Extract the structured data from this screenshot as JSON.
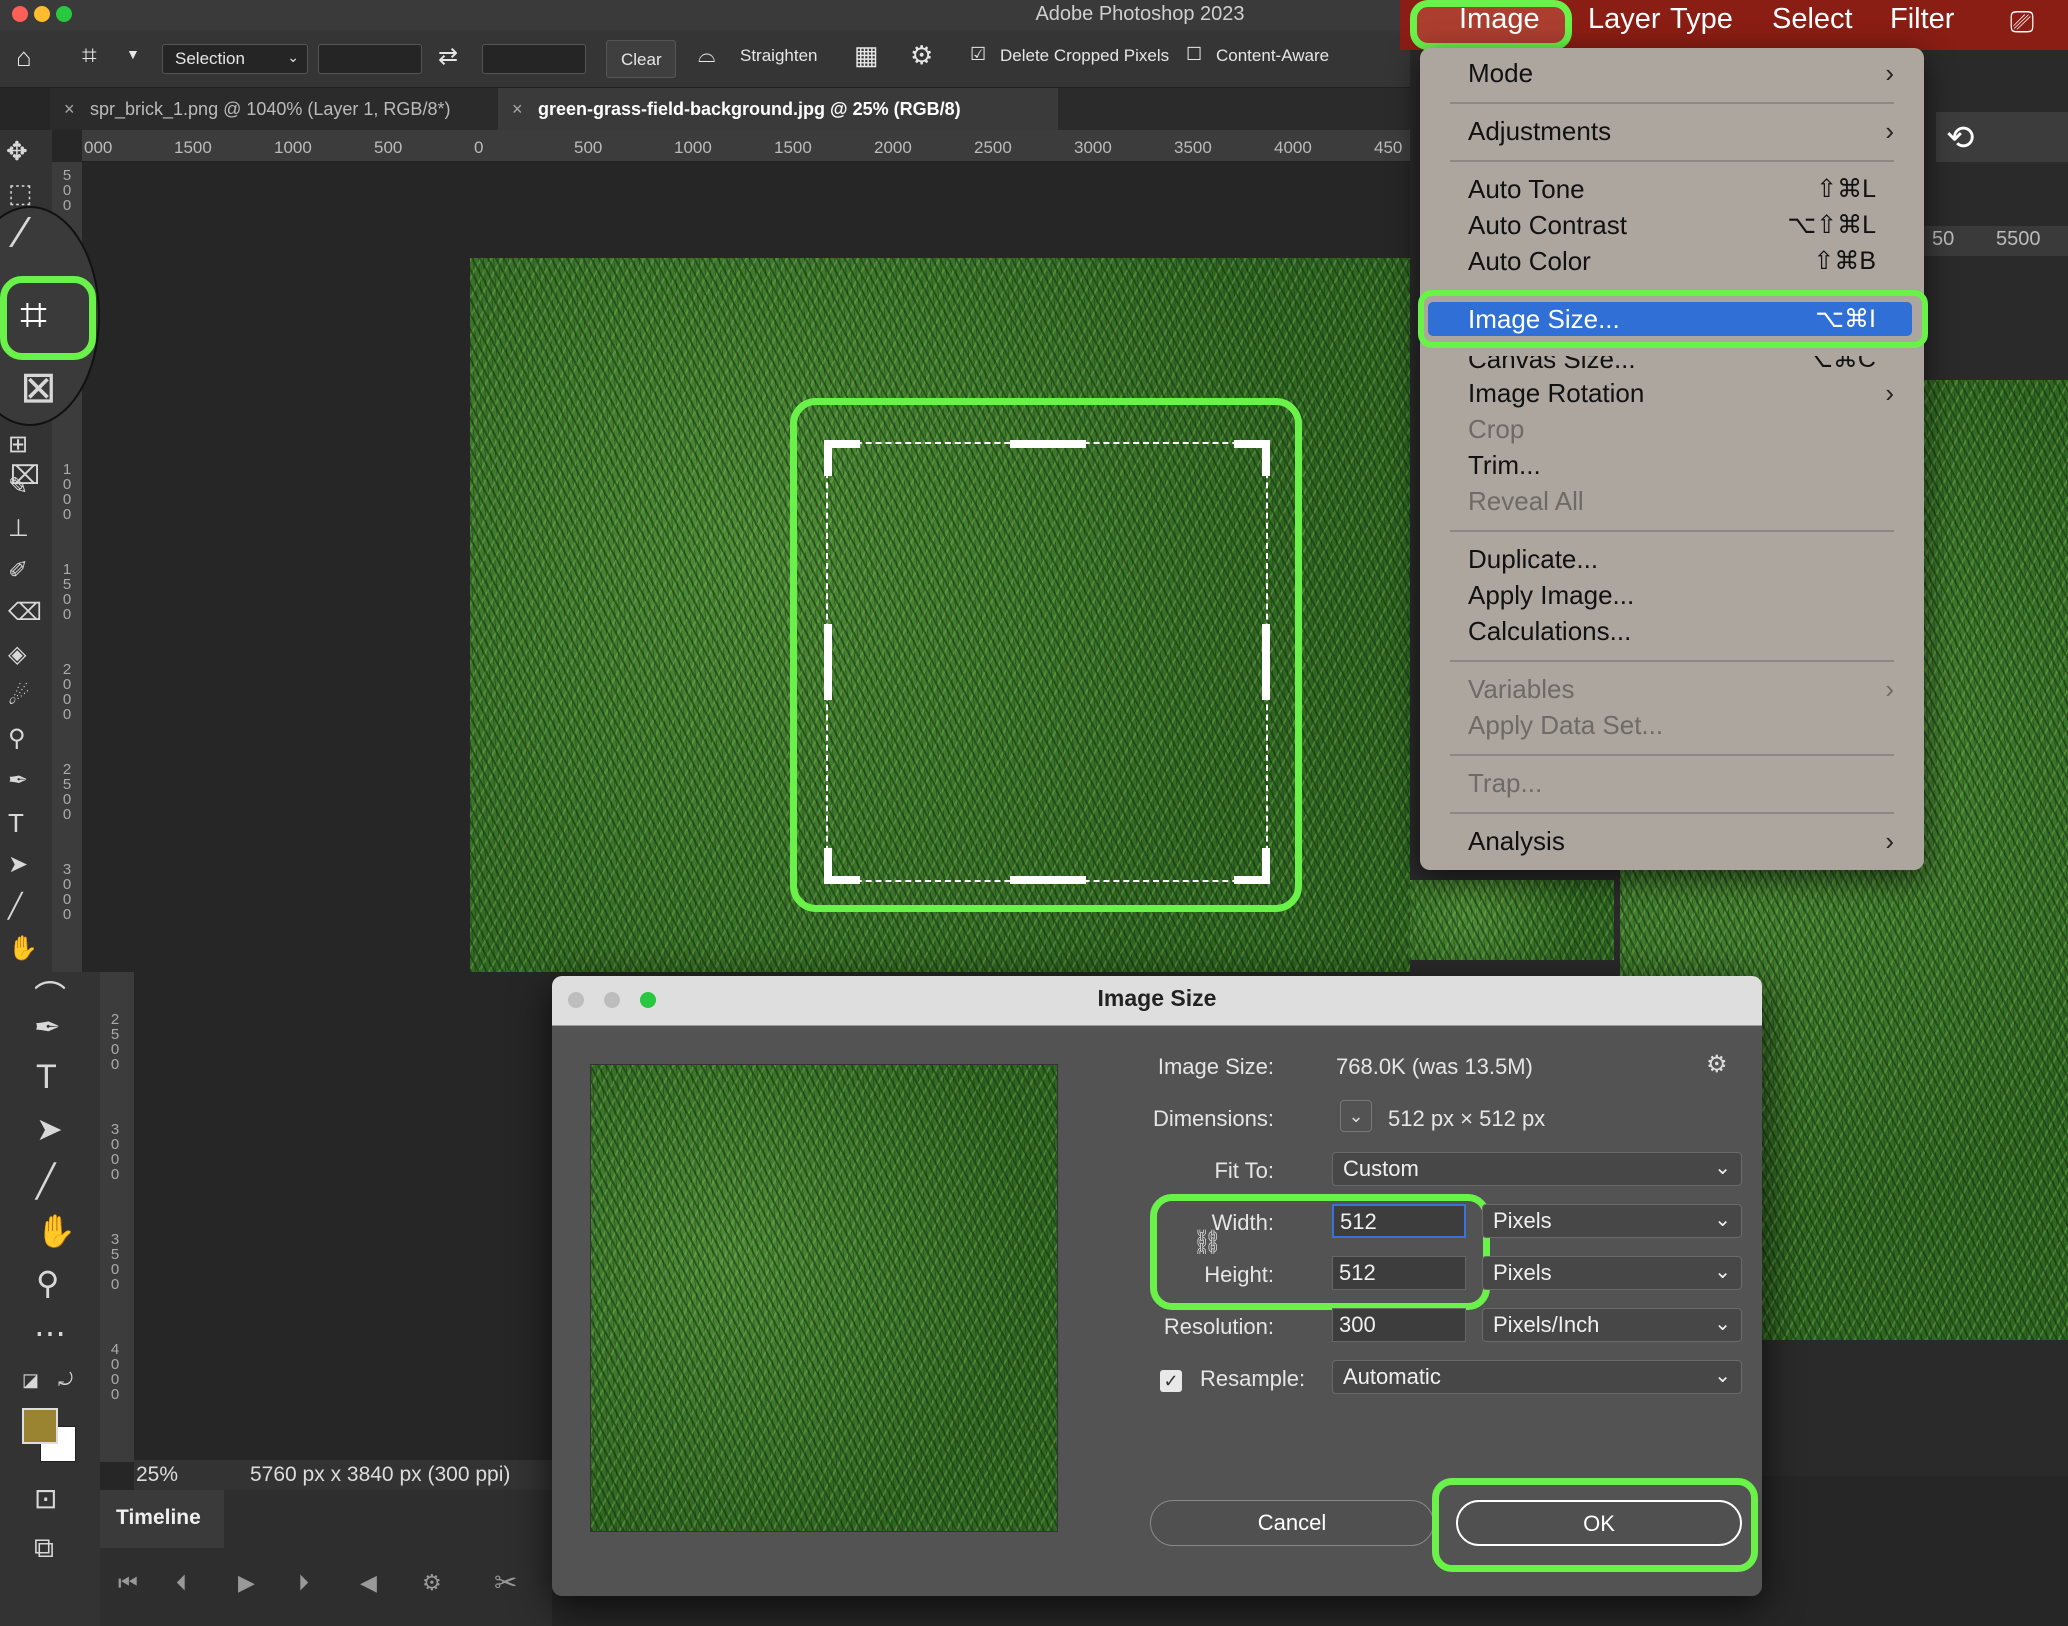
{
  "app": {
    "title": "Adobe Photoshop 2023",
    "menus": [
      "Image",
      "Layer",
      "Type",
      "Select",
      "Filter"
    ]
  },
  "options_bar": {
    "mode_select": "Selection",
    "clear_label": "Clear",
    "straighten_label": "Straighten",
    "delete_cropped_label": "Delete Cropped Pixels",
    "content_aware_label": "Content-Aware"
  },
  "tabs": [
    {
      "label": "spr_brick_1.png @ 1040% (Layer 1, RGB/8*)",
      "active": false
    },
    {
      "label": "green-grass-field-background.jpg @ 25% (RGB/8)",
      "active": true
    }
  ],
  "ruler": {
    "ticks": [
      "000",
      "1500",
      "1000",
      "500",
      "0",
      "500",
      "1000",
      "1500",
      "2000",
      "2500",
      "3000",
      "3500",
      "4000",
      "450"
    ],
    "vertical_ticks": [
      "500",
      "1000",
      "1500",
      "2000",
      "2500",
      "3000"
    ],
    "vertical_ticks_lower": [
      "2500",
      "3000",
      "3500",
      "4000"
    ],
    "right_tick": "5500",
    "right_tick_partial": "50"
  },
  "image_menu": {
    "items": [
      {
        "label": "Mode",
        "shortcut": "",
        "submenu": true,
        "disabled": false
      },
      {
        "label": "Adjustments",
        "shortcut": "",
        "submenu": true,
        "disabled": false
      },
      {
        "label": "Auto Tone",
        "shortcut": "⇧⌘L",
        "submenu": false,
        "disabled": false
      },
      {
        "label": "Auto Contrast",
        "shortcut": "⌥⇧⌘L",
        "submenu": false,
        "disabled": false
      },
      {
        "label": "Auto Color",
        "shortcut": "⇧⌘B",
        "submenu": false,
        "disabled": false
      },
      {
        "label": "Image Size...",
        "shortcut": "⌥⌘I",
        "submenu": false,
        "disabled": false,
        "highlighted": true
      },
      {
        "label": "Canvas Size...",
        "shortcut": "⌥⌘C",
        "submenu": false,
        "disabled": false
      },
      {
        "label": "Image Rotation",
        "shortcut": "",
        "submenu": true,
        "disabled": false
      },
      {
        "label": "Crop",
        "shortcut": "",
        "submenu": false,
        "disabled": true
      },
      {
        "label": "Trim...",
        "shortcut": "",
        "submenu": false,
        "disabled": false
      },
      {
        "label": "Reveal All",
        "shortcut": "",
        "submenu": false,
        "disabled": true
      },
      {
        "label": "Duplicate...",
        "shortcut": "",
        "submenu": false,
        "disabled": false
      },
      {
        "label": "Apply Image...",
        "shortcut": "",
        "submenu": false,
        "disabled": false
      },
      {
        "label": "Calculations...",
        "shortcut": "",
        "submenu": false,
        "disabled": false
      },
      {
        "label": "Variables",
        "shortcut": "",
        "submenu": true,
        "disabled": true
      },
      {
        "label": "Apply Data Set...",
        "shortcut": "",
        "submenu": false,
        "disabled": true
      },
      {
        "label": "Trap...",
        "shortcut": "",
        "submenu": false,
        "disabled": true
      },
      {
        "label": "Analysis",
        "shortcut": "",
        "submenu": true,
        "disabled": false
      }
    ]
  },
  "dialog": {
    "title": "Image Size",
    "image_size_label": "Image Size:",
    "image_size_value": "768.0K (was 13.5M)",
    "dimensions_label": "Dimensions:",
    "dimensions_value": "512 px  ×  512 px",
    "fit_to_label": "Fit To:",
    "fit_to_value": "Custom",
    "width_label": "Width:",
    "width_value": "512",
    "width_unit": "Pixels",
    "height_label": "Height:",
    "height_value": "512",
    "height_unit": "Pixels",
    "resolution_label": "Resolution:",
    "resolution_value": "300",
    "resolution_unit": "Pixels/Inch",
    "resample_label": "Resample:",
    "resample_value": "Automatic",
    "cancel_label": "Cancel",
    "ok_label": "OK"
  },
  "status": {
    "zoom": "25%",
    "doc_info": "5760 px x 3840 px (300 ppi)"
  },
  "timeline": {
    "label": "Timeline"
  },
  "colors": {
    "highlight_ring": "#6af24a",
    "menu_selection": "#2f6fd6",
    "foreground_swatch": "#9a8432",
    "menubar_accent": "#8a1d14"
  }
}
